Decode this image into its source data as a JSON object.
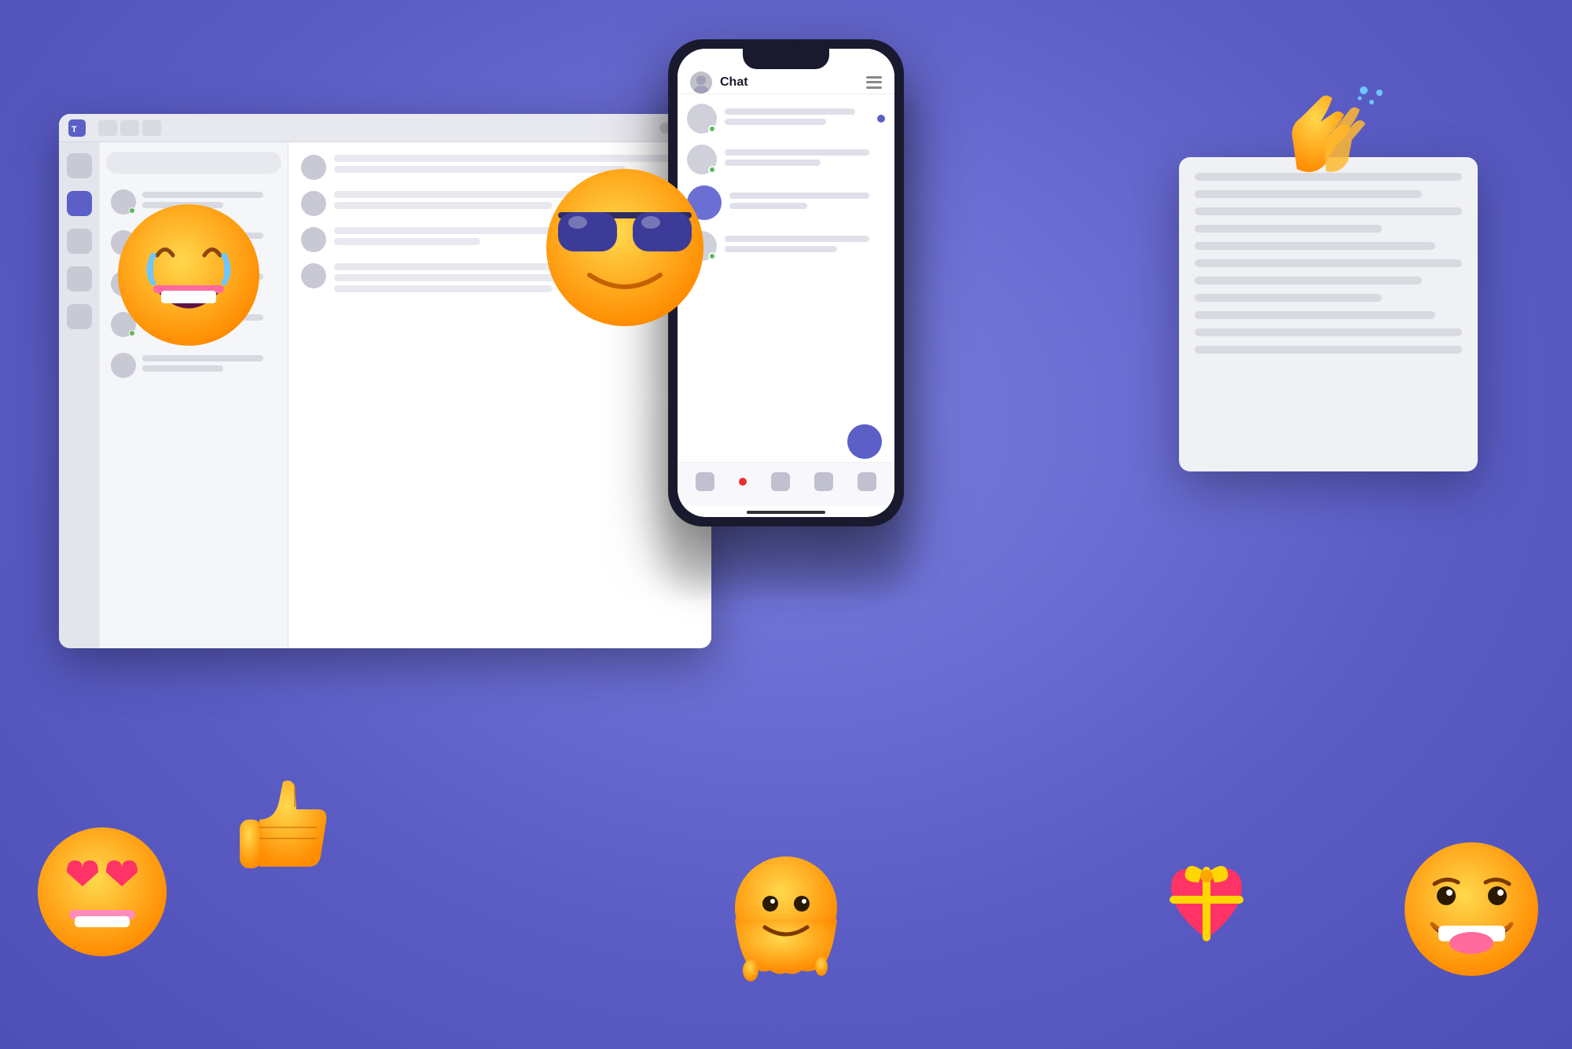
{
  "background": {
    "color": "#6b6fd4"
  },
  "phone": {
    "title": "Chat",
    "avatar_alt": "user avatar"
  },
  "desktop_window": {
    "title": "Microsoft Teams"
  },
  "emojis": {
    "laughing": "😂",
    "cool": "😎",
    "love": "😍",
    "thumbsup": "👍",
    "ghost": "😊",
    "clap": "👏",
    "heart_gift": "💝",
    "grin": "😁"
  }
}
